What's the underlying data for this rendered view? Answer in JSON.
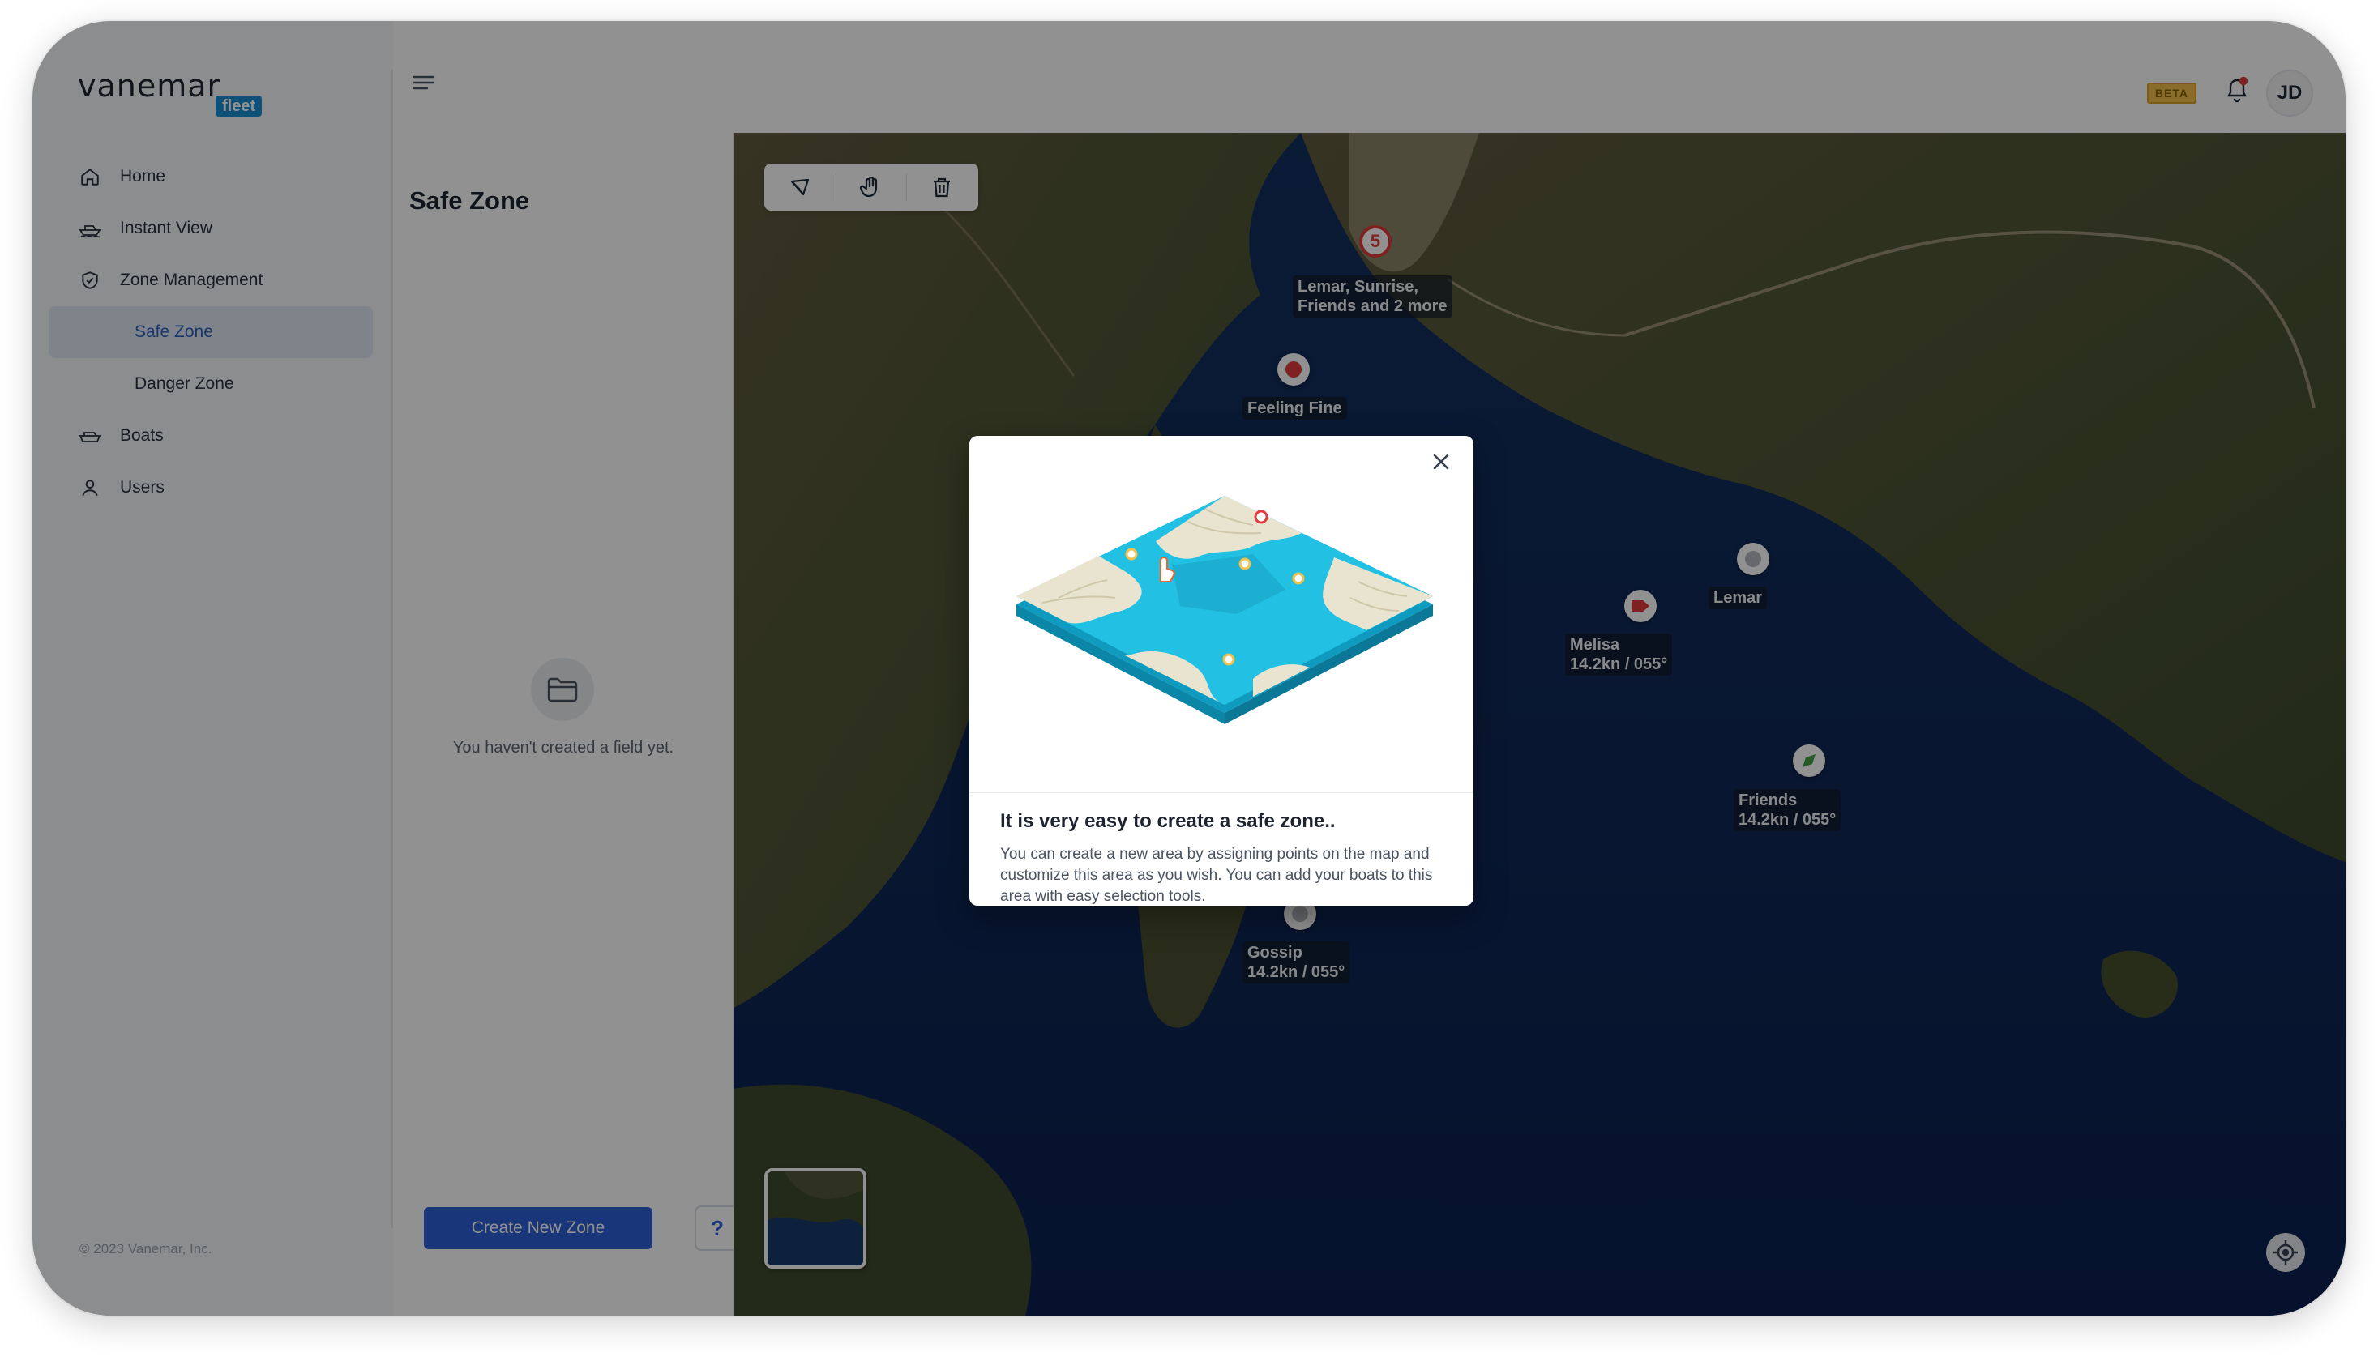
{
  "brand": {
    "name": "vanemar",
    "badge": "fleet"
  },
  "sidebar": {
    "items": [
      {
        "label": "Home",
        "icon": "home-icon"
      },
      {
        "label": "Instant View",
        "icon": "boat-view-icon"
      },
      {
        "label": "Zone Management",
        "icon": "shield-icon"
      },
      {
        "label": "Safe Zone",
        "active": true
      },
      {
        "label": "Danger Zone"
      },
      {
        "label": "Boats",
        "icon": "boat-icon"
      },
      {
        "label": "Users",
        "icon": "user-icon"
      }
    ],
    "copyright": "© 2023 Vanemar, Inc."
  },
  "topbar": {
    "beta": "BETA",
    "avatar": "JD"
  },
  "zone_panel": {
    "title": "Safe Zone",
    "empty_text": "You haven't created a field yet.",
    "create_label": "Create New Zone",
    "help_label": "?"
  },
  "map": {
    "cluster_count": "5",
    "labels": {
      "cluster": "Lemar, Sunrise,\nFriends and 2 more",
      "feeling_fine": "Feeling Fine",
      "lemar": "Lemar",
      "melisa": "Melisa\n14.2kn / 055°",
      "friends": "Friends\n14.2kn / 055°",
      "gossip": "Gossip\n14.2kn / 055°"
    },
    "colors": {
      "red": "#e23b3b",
      "green": "#43a047",
      "grey": "#9aa0a6"
    }
  },
  "modal": {
    "title": "It is very easy to create a safe zone..",
    "text": "You can create a new area by assigning points on the map and customize this area as you wish. You can add your boats to this area with easy selection tools."
  }
}
